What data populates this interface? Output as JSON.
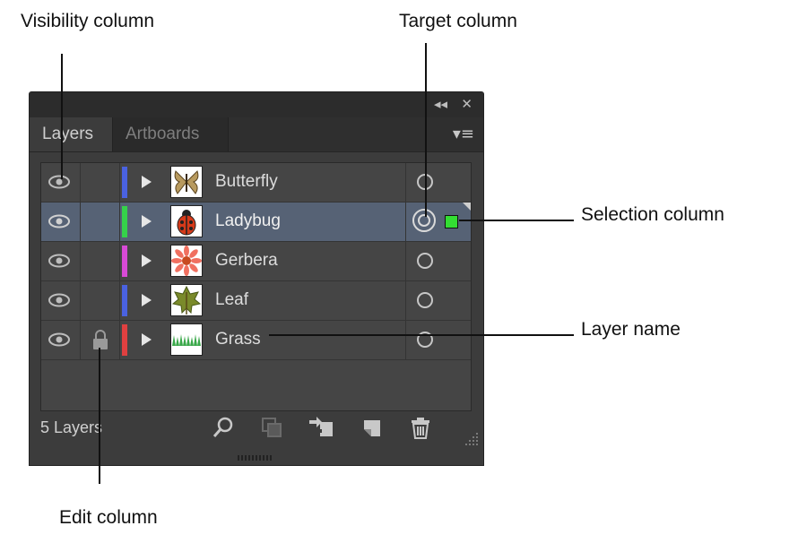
{
  "callouts": {
    "visibility": "Visibility column",
    "target": "Target column",
    "selection": "Selection column",
    "layer_name": "Layer name",
    "edit": "Edit column"
  },
  "panel": {
    "tabs": [
      "Layers",
      "Artboards"
    ],
    "status": "5 Layers",
    "layers": [
      {
        "name": "Butterfly",
        "color": "#4a62e0",
        "selected": false,
        "locked": false,
        "thumb": "butterfly"
      },
      {
        "name": "Ladybug",
        "color": "#35d24a",
        "selected": true,
        "locked": false,
        "thumb": "ladybug"
      },
      {
        "name": "Gerbera",
        "color": "#d84ad6",
        "selected": false,
        "locked": false,
        "thumb": "gerbera"
      },
      {
        "name": "Leaf",
        "color": "#4a62e0",
        "selected": false,
        "locked": false,
        "thumb": "leaf"
      },
      {
        "name": "Grass",
        "color": "#e04040",
        "selected": false,
        "locked": true,
        "thumb": "grass"
      }
    ],
    "footer_icons": [
      "search-icon",
      "clipping-mask-icon",
      "new-sublayer-icon",
      "new-layer-icon",
      "trash-icon"
    ]
  }
}
